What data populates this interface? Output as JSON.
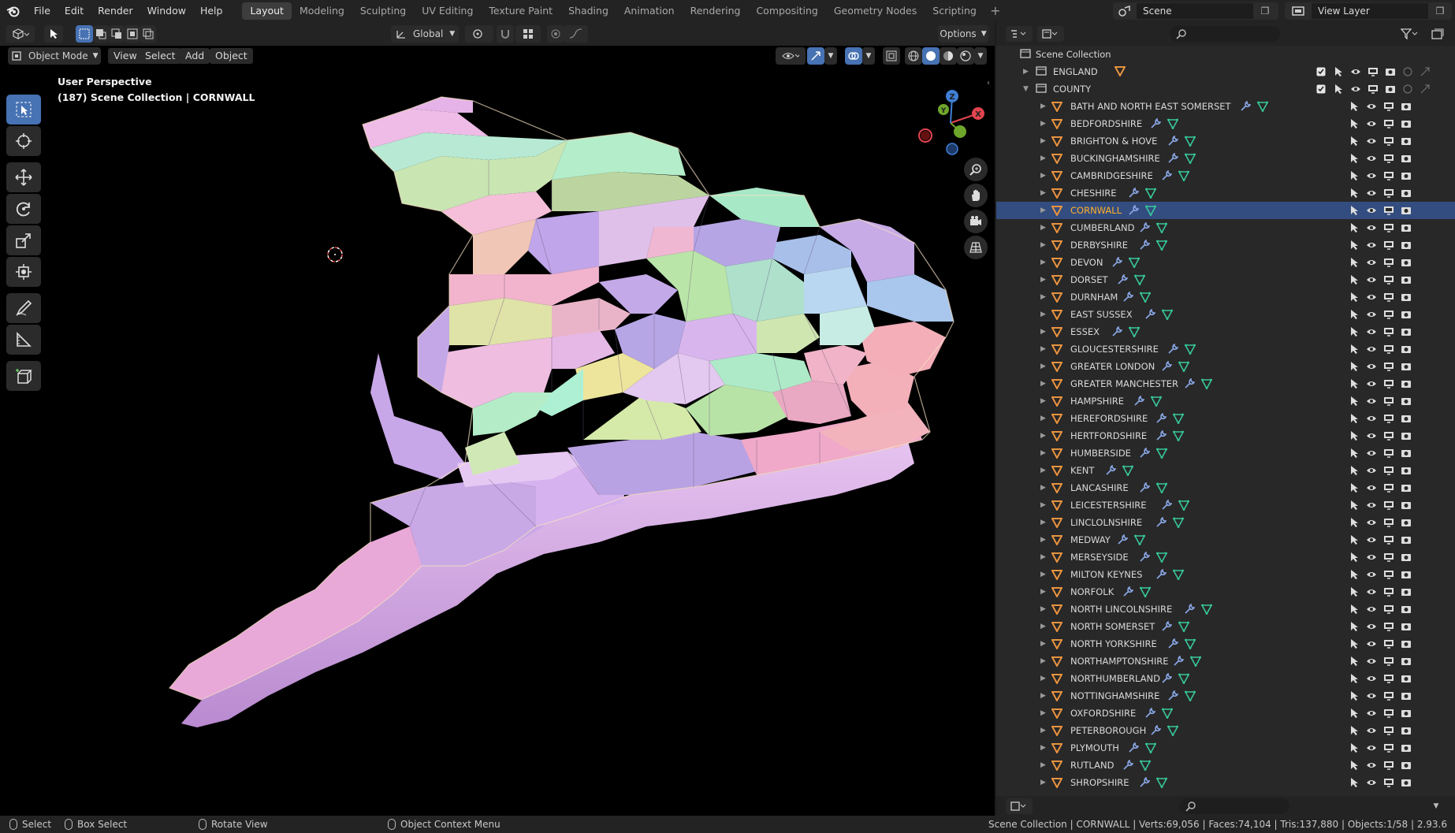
{
  "topbar": {
    "menus": [
      "File",
      "Edit",
      "Render",
      "Window",
      "Help"
    ],
    "workspaces": [
      "Layout",
      "Modeling",
      "Sculpting",
      "UV Editing",
      "Texture Paint",
      "Shading",
      "Animation",
      "Rendering",
      "Compositing",
      "Geometry Nodes",
      "Scripting"
    ],
    "active_workspace": "Layout",
    "add_tab": "+",
    "scene": "Scene",
    "view_layer": "View Layer"
  },
  "viewport": {
    "orientation": "Global",
    "options": "Options",
    "mode": "Object Mode",
    "menus": [
      "View",
      "Select",
      "Add",
      "Object"
    ],
    "info_line1": "User Perspective",
    "info_line2": "(187) Scene Collection | CORNWALL",
    "gizmo": {
      "x": "X",
      "y": "Y",
      "z": "Z"
    }
  },
  "outliner": {
    "root": "Scene Collection",
    "collections": [
      {
        "name": "ENGLAND",
        "expanded": false
      },
      {
        "name": "COUNTY",
        "expanded": true
      }
    ],
    "objects": [
      "BATH AND NORTH EAST SOMERSET",
      "BEDFORDSHIRE",
      "BRIGHTON & HOVE",
      "BUCKINGHAMSHIRE",
      "CAMBRIDGESHIRE",
      "CHESHIRE",
      "CORNWALL",
      "CUMBERLAND",
      "DERBYSHIRE",
      "DEVON",
      "DORSET",
      "DURNHAM",
      "EAST SUSSEX",
      "ESSEX",
      "GLOUCESTERSHIRE",
      "GREATER LONDON",
      "GREATER MANCHESTER",
      "HAMPSHIRE",
      "HEREFORDSHIRE",
      "HERTFORDSHIRE",
      "HUMBERSIDE",
      "KENT",
      "LANCASHIRE",
      "LEICESTERSHIRE",
      "LINCLOLNSHIRE",
      "MEDWAY",
      "MERSEYSIDE",
      "MILTON KEYNES",
      "NORFOLK",
      "NORTH LINCOLNSHIRE",
      "NORTH SOMERSET",
      "NORTH YORKSHIRE",
      "NORTHAMPTONSHIRE",
      "NORTHUMBERLAND",
      "NOTTINGHAMSHIRE",
      "OXFORDSHIRE",
      "PETERBOROUGH",
      "PLYMOUTH",
      "RUTLAND",
      "SHROPSHIRE"
    ],
    "selected": "CORNWALL"
  },
  "statusbar": {
    "select": "Select",
    "box_select": "Box Select",
    "rotate_view": "Rotate View",
    "context_menu": "Object Context Menu",
    "stats": "Scene Collection | CORNWALL | Verts:69,056 | Faces:74,104 | Tris:137,880 | Objects:1/58 | 2.93.6"
  },
  "colors": {
    "accent": "#4772b3",
    "selected_row": "#334d80",
    "selected_text": "#ffaf29",
    "object_icon": "#e9933f",
    "modifier_icon": "#8aa7e6",
    "mesh_icon": "#37c79a",
    "gizmo_x": "#e2444e",
    "gizmo_y": "#6ea62b",
    "gizmo_z": "#3f7fd6"
  },
  "icons": {
    "row": [
      "object-triangle-icon",
      "wrench-icon",
      "mesh-data-icon",
      "select-arrow-icon",
      "eye-icon",
      "monitor-icon",
      "camera-icon"
    ],
    "toolbar": [
      "select-box-icon",
      "cursor-icon",
      "move-icon",
      "rotate-icon",
      "scale-icon",
      "transform-icon",
      "annotate-icon",
      "measure-icon",
      "add-cube-icon"
    ]
  }
}
